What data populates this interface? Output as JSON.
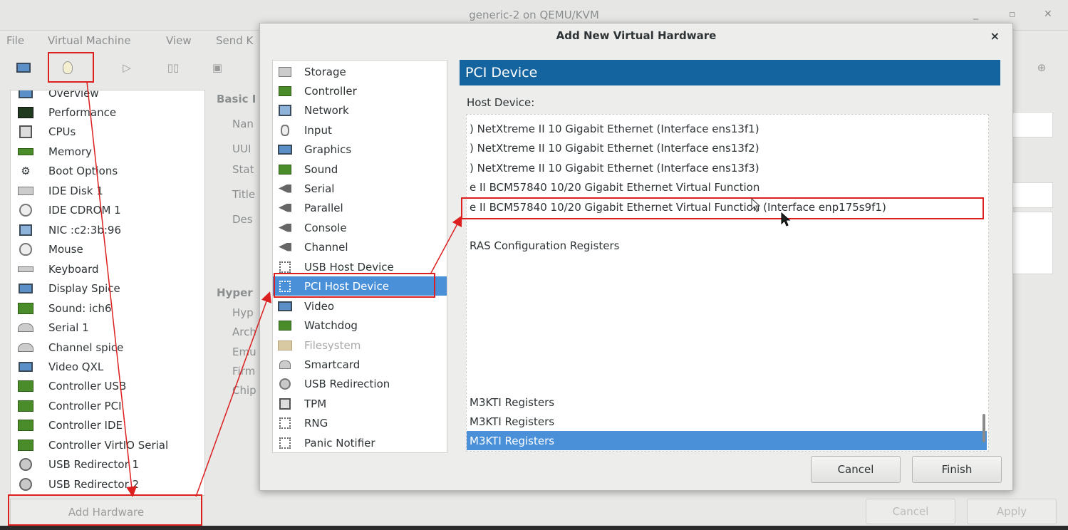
{
  "window": {
    "title": "generic-2 on QEMU/KVM",
    "minimize": "_",
    "maximize": "▫",
    "close": "✕"
  },
  "menubar": [
    "File",
    "Virtual Machine",
    "View",
    "Send K"
  ],
  "sidebar": {
    "items": [
      {
        "label": "Overview",
        "icon": "monitor-icon"
      },
      {
        "label": "Performance",
        "icon": "performance-icon"
      },
      {
        "label": "CPUs",
        "icon": "cpu-icon"
      },
      {
        "label": "Memory",
        "icon": "memory-icon"
      },
      {
        "label": "Boot Options",
        "icon": "gears-icon"
      },
      {
        "label": "IDE Disk 1",
        "icon": "disk-icon"
      },
      {
        "label": "IDE CDROM 1",
        "icon": "cdrom-icon"
      },
      {
        "label": "NIC :c2:3b:96",
        "icon": "network-icon"
      },
      {
        "label": "Mouse",
        "icon": "mouse-icon"
      },
      {
        "label": "Keyboard",
        "icon": "keyboard-icon"
      },
      {
        "label": "Display Spice",
        "icon": "display-icon"
      },
      {
        "label": "Sound: ich6",
        "icon": "sound-icon"
      },
      {
        "label": "Serial 1",
        "icon": "serial-icon"
      },
      {
        "label": "Channel spice",
        "icon": "channel-icon"
      },
      {
        "label": "Video QXL",
        "icon": "video-icon"
      },
      {
        "label": "Controller USB",
        "icon": "controller-icon"
      },
      {
        "label": "Controller PCI",
        "icon": "controller-icon"
      },
      {
        "label": "Controller IDE",
        "icon": "controller-icon"
      },
      {
        "label": "Controller VirtIO Serial",
        "icon": "controller-icon"
      },
      {
        "label": "USB Redirector 1",
        "icon": "usb-redirector-icon"
      },
      {
        "label": "USB Redirector 2",
        "icon": "usb-redirector-icon"
      }
    ],
    "add_hardware": "Add Hardware"
  },
  "background": {
    "basic": "Basic I",
    "fields": [
      "Nan",
      "UUI",
      "Stat",
      "Title",
      "Des"
    ],
    "hyper": "Hyper",
    "hyper_fields": [
      "Hyp",
      "Arch",
      "Emu",
      "Firm",
      "Chip"
    ],
    "cancel": "Cancel",
    "apply": "Apply"
  },
  "dialog": {
    "title": "Add New Virtual Hardware",
    "close": "×",
    "types": [
      {
        "label": "Storage",
        "icon": "storage-icon"
      },
      {
        "label": "Controller",
        "icon": "controller-icon"
      },
      {
        "label": "Network",
        "icon": "network-icon"
      },
      {
        "label": "Input",
        "icon": "input-icon"
      },
      {
        "label": "Graphics",
        "icon": "graphics-icon"
      },
      {
        "label": "Sound",
        "icon": "sound-icon"
      },
      {
        "label": "Serial",
        "icon": "serial-icon"
      },
      {
        "label": "Parallel",
        "icon": "parallel-icon"
      },
      {
        "label": "Console",
        "icon": "console-icon"
      },
      {
        "label": "Channel",
        "icon": "channel-icon"
      },
      {
        "label": "USB Host Device",
        "icon": "usb-host-icon"
      },
      {
        "label": "PCI Host Device",
        "icon": "pci-host-icon"
      },
      {
        "label": "Video",
        "icon": "video-icon"
      },
      {
        "label": "Watchdog",
        "icon": "watchdog-icon"
      },
      {
        "label": "Filesystem",
        "icon": "filesystem-icon"
      },
      {
        "label": "Smartcard",
        "icon": "smartcard-icon"
      },
      {
        "label": "USB Redirection",
        "icon": "usb-redirection-icon"
      },
      {
        "label": "TPM",
        "icon": "tpm-icon"
      },
      {
        "label": "RNG",
        "icon": "rng-icon"
      },
      {
        "label": "Panic Notifier",
        "icon": "panic-icon"
      }
    ],
    "selected_type": "PCI Host Device",
    "header": "PCI Device",
    "host_label": "Host Device:",
    "host_devices": [
      ") NetXtreme II 10 Gigabit Ethernet (Interface ens13f1)",
      ") NetXtreme II 10 Gigabit Ethernet (Interface ens13f2)",
      ") NetXtreme II 10 Gigabit Ethernet (Interface ens13f3)",
      "e II BCM57840 10/20 Gigabit Ethernet Virtual Function",
      "e II BCM57840 10/20 Gigabit Ethernet Virtual Function (Interface enp175s9f1)",
      "",
      "RAS Configuration Registers",
      "",
      "",
      "",
      "",
      "",
      "",
      "",
      "",
      "M3KTI Registers",
      "M3KTI Registers",
      "M3KTI Registers"
    ],
    "selected_host_index": 17,
    "cancel": "Cancel",
    "finish": "Finish"
  }
}
